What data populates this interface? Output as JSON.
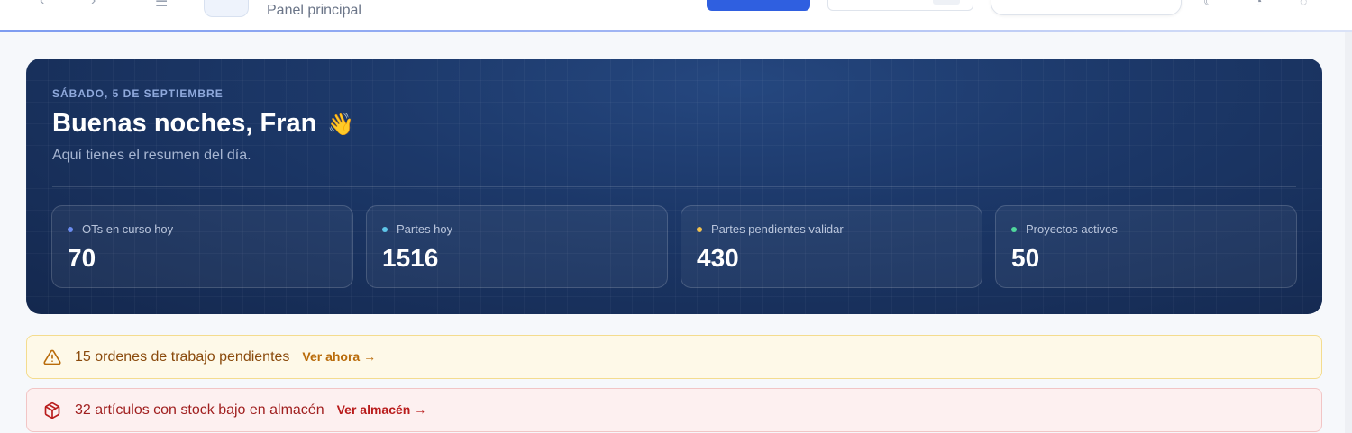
{
  "header": {
    "breadcrumb": "Panel principal",
    "progress_color": "#7e9cf0"
  },
  "hero": {
    "date": "SÁBADO, 5 DE SEPTIEMBRE",
    "greeting": "Buenas noches, Fran",
    "greeting_emoji": "👋",
    "subtitle": "Aquí tienes el resumen del día.",
    "stats": [
      {
        "label": "OTs en curso hoy",
        "value": "70",
        "dot_color": "#6b8cf0"
      },
      {
        "label": "Partes hoy",
        "value": "1516",
        "dot_color": "#5ec5e8"
      },
      {
        "label": "Partes pendientes validar",
        "value": "430",
        "dot_color": "#f2c14e"
      },
      {
        "label": "Proyectos activos",
        "value": "50",
        "dot_color": "#4fd69c"
      }
    ]
  },
  "alerts": [
    {
      "type": "warning",
      "icon": "warning-triangle-icon",
      "message": "15 ordenes de trabajo pendientes",
      "link": "Ver ahora →"
    },
    {
      "type": "danger",
      "icon": "package-box-icon",
      "message": "32 artículos con stock bajo en almacén",
      "link": "Ver almacén →"
    }
  ],
  "colors": {
    "accent": "#2f5fe0",
    "hero_bg": "#1c3869",
    "warning_bg": "#fef9e8",
    "danger_bg": "#fdf0f0"
  }
}
